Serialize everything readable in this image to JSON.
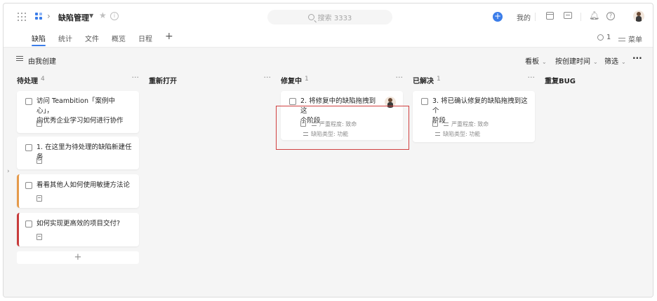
{
  "header": {
    "project_title": "缺陷管理",
    "search_placeholder": "搜索 3333",
    "mine_label": "我的"
  },
  "tabs": [
    {
      "label": "缺陷",
      "active": true
    },
    {
      "label": "统计"
    },
    {
      "label": "文件"
    },
    {
      "label": "概览"
    },
    {
      "label": "日程"
    }
  ],
  "tab_add": "+",
  "members": {
    "count": "1",
    "menu_label": "菜单"
  },
  "filterbar": {
    "filter_label": "由我创建",
    "view_label": "看板",
    "sort_label": "按创建时间",
    "filter_btn": "筛选",
    "more": "···"
  },
  "columns": [
    {
      "title": "待处理",
      "count": "4"
    },
    {
      "title": "重新打开",
      "count": ""
    },
    {
      "title": "修复中",
      "count": "1"
    },
    {
      "title": "已解决",
      "count": "1"
    },
    {
      "title": "重复BUG",
      "count": ""
    }
  ],
  "col_more": "···",
  "cards": {
    "todo": [
      {
        "line1": "访问 Teambition「案例中心」，",
        "line2": "向优秀企业学习如何进行协作"
      },
      {
        "line1": "1. 在这里为待处理的缺陷新建任务",
        "line2": ""
      },
      {
        "line1": "看看其他人如何使用敏捷方法论",
        "line2": ""
      },
      {
        "line1": "如何实现更高效的项目交付?",
        "line2": ""
      }
    ],
    "fixing": {
      "line1": "2. 将修复中的缺陷拖拽到这",
      "line2": "个阶段",
      "severity": "严重程度: 致命",
      "type": "缺陷类型: 功能"
    },
    "resolved": {
      "line1": "3. 将已确认修复的缺陷拖拽到这个",
      "line2": "阶段",
      "severity": "严重程度: 致命",
      "type": "缺陷类型: 功能"
    }
  },
  "add_card": "+",
  "colors": {
    "accent": "#3b7de9",
    "orange_bar": "#e59a4a",
    "red_bar": "#c83b3b",
    "highlight": "#d04040"
  },
  "icons": [
    "apps-grid-icon",
    "app-icon",
    "star-icon",
    "info-icon",
    "search-icon",
    "plus-circle-icon",
    "calendar-icon",
    "message-icon",
    "bell-icon",
    "help-icon",
    "user-icon",
    "menu-icon",
    "list-icon",
    "checkbox-icon",
    "doc-icon"
  ]
}
